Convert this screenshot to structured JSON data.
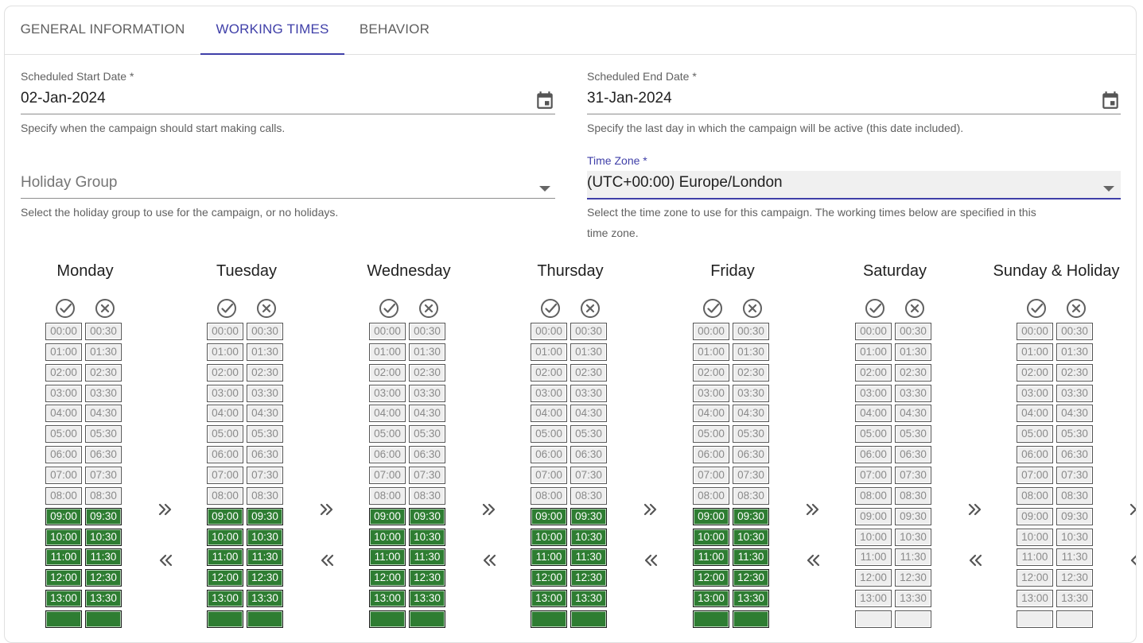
{
  "tabs": [
    {
      "label": "GENERAL INFORMATION",
      "active": false
    },
    {
      "label": "WORKING TIMES",
      "active": true
    },
    {
      "label": "BEHAVIOR",
      "active": false
    }
  ],
  "start_date": {
    "label": "Scheduled Start Date *",
    "value": "02-Jan-2024",
    "hint": "Specify when the campaign should start making calls.",
    "icon": "calendar-icon"
  },
  "end_date": {
    "label": "Scheduled End Date *",
    "value": "31-Jan-2024",
    "hint": "Specify the last day in which the campaign will be active (this date included).",
    "icon": "calendar-icon"
  },
  "holiday_group": {
    "placeholder": "Holiday Group",
    "hint": "Select the holiday group to use for the campaign, or no holidays.",
    "icon": "dropdown-arrow-icon"
  },
  "time_zone": {
    "label": "Time Zone *",
    "value": "(UTC+00:00) Europe/London",
    "hint_line1": "Select the time zone to use for this campaign. The working times below are specified in this",
    "hint_line2": "time zone.",
    "icon": "dropdown-arrow-icon"
  },
  "colors": {
    "accent": "#3f3fa8",
    "slot_active": "#2e7d32",
    "slot_inactive": "#eeeeee"
  },
  "slot_times": [
    [
      "00:00",
      "00:30"
    ],
    [
      "01:00",
      "01:30"
    ],
    [
      "02:00",
      "02:30"
    ],
    [
      "03:00",
      "03:30"
    ],
    [
      "04:00",
      "04:30"
    ],
    [
      "05:00",
      "05:30"
    ],
    [
      "06:00",
      "06:30"
    ],
    [
      "07:00",
      "07:30"
    ],
    [
      "08:00",
      "08:30"
    ],
    [
      "09:00",
      "09:30"
    ],
    [
      "10:00",
      "10:30"
    ],
    [
      "11:00",
      "11:30"
    ],
    [
      "12:00",
      "12:30"
    ],
    [
      "13:00",
      "13:30"
    ]
  ],
  "days": [
    {
      "name": "Monday",
      "active_from_row": 9
    },
    {
      "name": "Tuesday",
      "active_from_row": 9
    },
    {
      "name": "Wednesday",
      "active_from_row": 9
    },
    {
      "name": "Thursday",
      "active_from_row": 9
    },
    {
      "name": "Friday",
      "active_from_row": 9
    },
    {
      "name": "Saturday",
      "active_from_row": null
    },
    {
      "name": "Sunday & Holiday",
      "active_from_row": null
    }
  ],
  "day_actions": {
    "select_all_icon": "check-circle-icon",
    "clear_all_icon": "cancel-circle-icon"
  },
  "copy_actions": {
    "copy_forward_icon": "double-chevron-right-icon",
    "copy_back_icon": "double-chevron-left-icon"
  }
}
